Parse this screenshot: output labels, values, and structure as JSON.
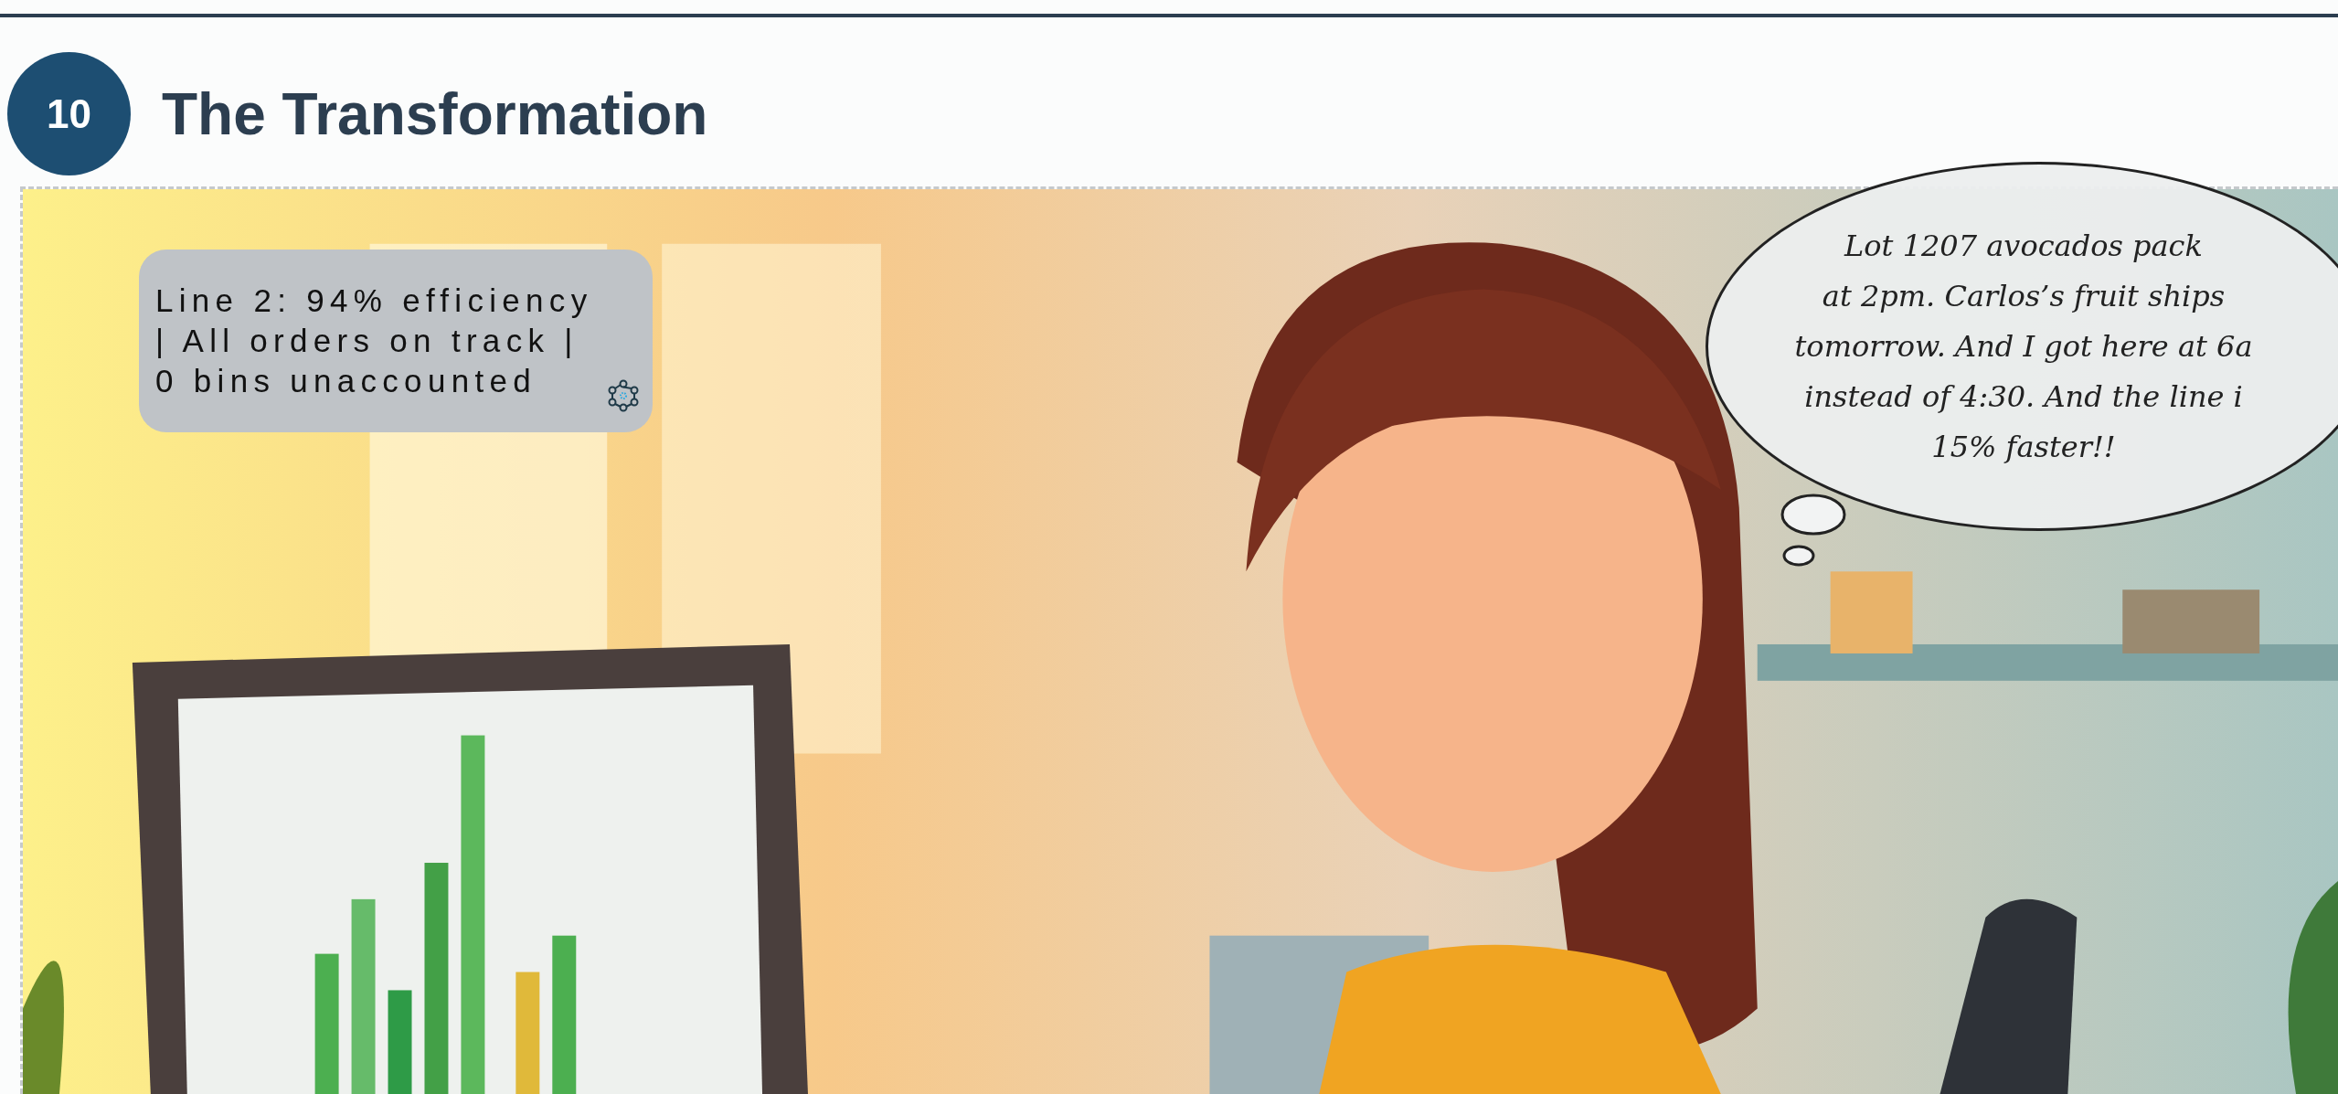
{
  "step": {
    "number": "10",
    "title": "The Transformation"
  },
  "status_note": {
    "text": "Line 2: 94% efficiency\n| All orders on track |\n0 bins unaccounted"
  },
  "thought_bubble": {
    "text": "Lot 1207 avocados pack\nat 2pm. Carlos’s fruit ships\ntomorrow. And I got here at 6a\ninstead of 4:30. And the line i\n15% faster!!"
  }
}
